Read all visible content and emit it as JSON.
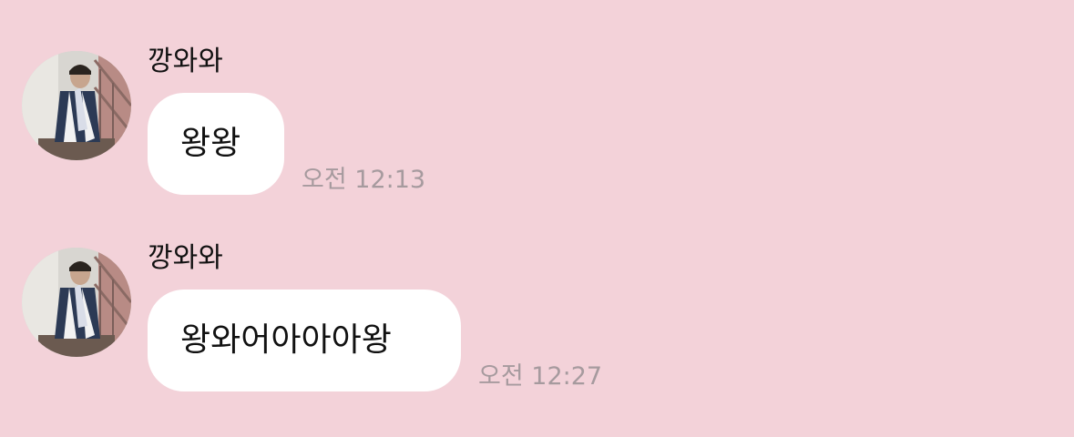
{
  "chat": {
    "background_color": "#f3d2d9",
    "messages": [
      {
        "sender_name": "깡와와",
        "avatar_icon": "profile-photo",
        "text": "왕왕",
        "time": "오전 12:13"
      },
      {
        "sender_name": "깡와와",
        "avatar_icon": "profile-photo",
        "text": "왕와어아아아왕",
        "time": "오전 12:27"
      }
    ]
  }
}
